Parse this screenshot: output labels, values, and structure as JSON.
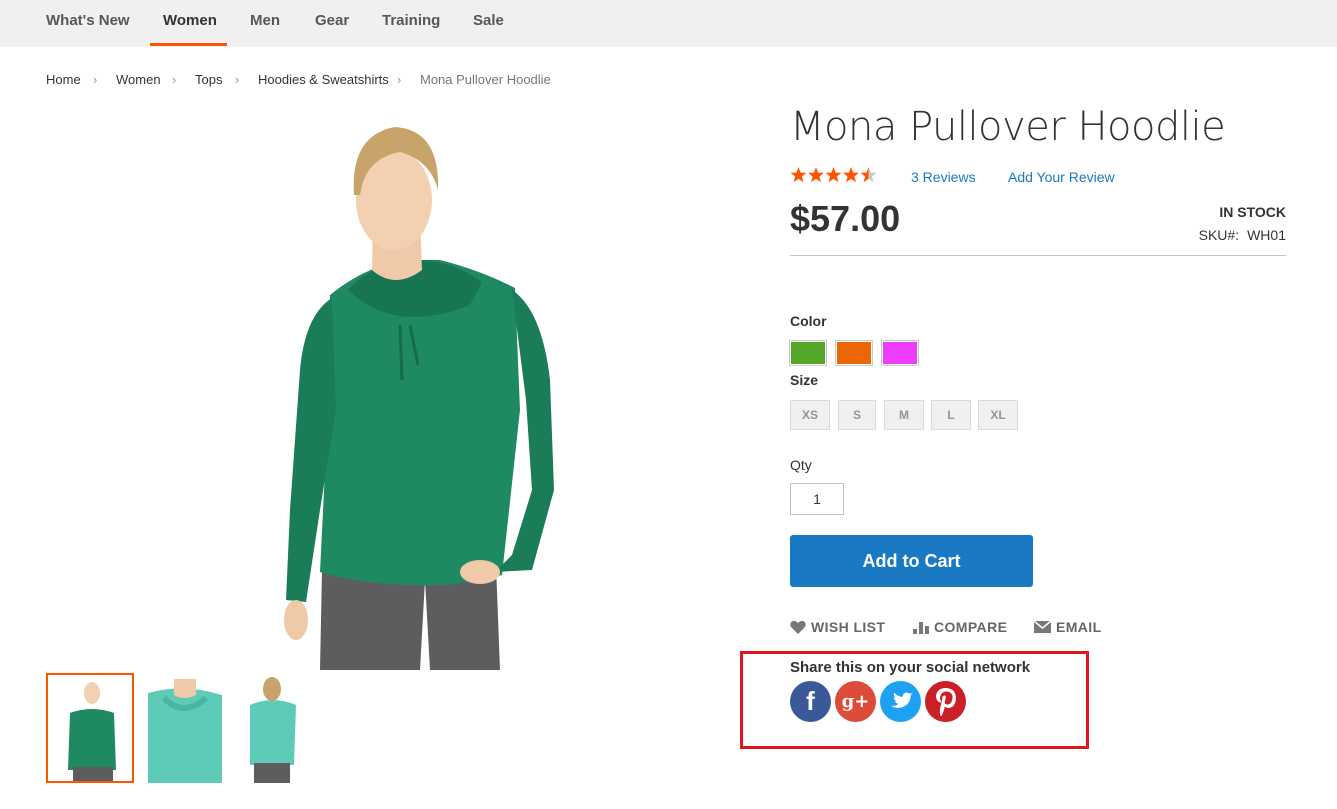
{
  "nav": {
    "items": [
      "What's New",
      "Women",
      "Men",
      "Gear",
      "Training",
      "Sale"
    ],
    "active": "Women"
  },
  "breadcrumb": {
    "items": [
      "Home",
      "Women",
      "Tops",
      "Hoodies & Sweatshirts"
    ],
    "current": "Mona Pullover Hoodlie",
    "separator": "›"
  },
  "product": {
    "name": "Mona Pullover Hoodlie",
    "rating_stars": 4.5,
    "rating_max": 5,
    "reviews_link": "3 Reviews",
    "add_review_link": "Add Your Review",
    "price": "$57.00",
    "stock": "IN STOCK",
    "sku_label": "SKU#:",
    "sku": "WH01"
  },
  "options": {
    "color_label": "Color",
    "colors": [
      "#53a828",
      "#eb6703",
      "#ef3dff"
    ],
    "size_label": "Size",
    "sizes": [
      "XS",
      "S",
      "M",
      "L",
      "XL"
    ],
    "qty_label": "Qty",
    "qty_value": "1"
  },
  "cart": {
    "button_label": "Add to Cart"
  },
  "actions": {
    "wishlist": "WISH LIST",
    "compare": "COMPARE",
    "email": "EMAIL"
  },
  "share": {
    "title": "Share this on your social network",
    "networks": [
      {
        "name": "facebook",
        "color": "#3b5998",
        "glyph": "f"
      },
      {
        "name": "google-plus",
        "color": "#dd4b39",
        "glyph": "g+"
      },
      {
        "name": "twitter",
        "color": "#1da1f2",
        "glyph": "t"
      },
      {
        "name": "pinterest",
        "color": "#cb2027",
        "glyph": "p"
      }
    ]
  },
  "colors": {
    "accent_orange": "#ff5501",
    "link_blue": "#1979c3",
    "highlight_red": "#e0151f",
    "hoodie_green": "#1f8a62",
    "hoodie_teal": "#5ecbb9"
  }
}
